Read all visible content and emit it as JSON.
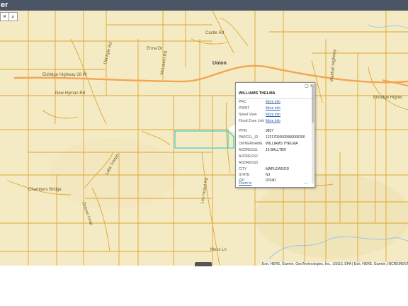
{
  "app": {
    "title": "er"
  },
  "toolbar": {
    "close_glyph": "×",
    "search_glyph": "⌕"
  },
  "colors": {
    "parcel_line": "#e0a630",
    "highway": "#f2a552",
    "selected_parcel": "#32c7cf",
    "map_bg": "#f4ebc4"
  },
  "map_labels": {
    "erma_dr": "Erma Dr",
    "union_town": "Union",
    "highway_28_w": "Eldridge Highway 28 W",
    "new_hyman_rd": "New Hyman Rd",
    "les_hoard_rd": "Les Hoard Rd",
    "lake_tristan": "Lake Tristan",
    "mclaurin_rd": "McLaurin Rd",
    "old_kyle_rd": "Old Kyle Rd",
    "chambers_bridge": "Chambers Bridge",
    "dotson_loop": "Dotson Loop",
    "moss_ln": "Moss Ln",
    "walthall_hwy": "Walthall Highway",
    "east_hwy": "Eldridge Highw",
    "castle_rd": "Castle Rd"
  },
  "popup": {
    "title": "WILLIAMS THELMA",
    "controls": {
      "maximize": "▢",
      "close": "✕"
    },
    "fields": [
      {
        "key": "PRC",
        "value": "More info",
        "link": true
      },
      {
        "key": "PRINT",
        "value": "More info",
        "link": true
      },
      {
        "key": "Street View",
        "value": "More info",
        "link": true
      },
      {
        "key": "Flood Zone Link",
        "value": "More info",
        "link": true
      },
      {
        "key": "PPIN",
        "value": "9827",
        "link": false
      },
      {
        "key": "PARCEL_ID",
        "value": "12217020000000000200",
        "link": false
      },
      {
        "key": "OWNERNAME",
        "value": "WILLIAMS THELMA",
        "link": false
      },
      {
        "key": "ADDRESS1",
        "value": "15 BALLTER",
        "link": false
      },
      {
        "key": "ADDRESS2",
        "value": "",
        "link": false
      },
      {
        "key": "ADDRESS3",
        "value": "",
        "link": false
      },
      {
        "key": "CITY",
        "value": "MAPLEWOOD",
        "link": false
      },
      {
        "key": "STATE",
        "value": "NJ",
        "link": false
      },
      {
        "key": "ZIP",
        "value": "07040",
        "link": false
      }
    ],
    "zoom_to": "Zoom to",
    "more": "..."
  },
  "attribution": "Esri, HERE, Garmin, GeoTechnologies, Inc., USGS, EPA | Esri, HERE, Garmin, INCREMENT P"
}
